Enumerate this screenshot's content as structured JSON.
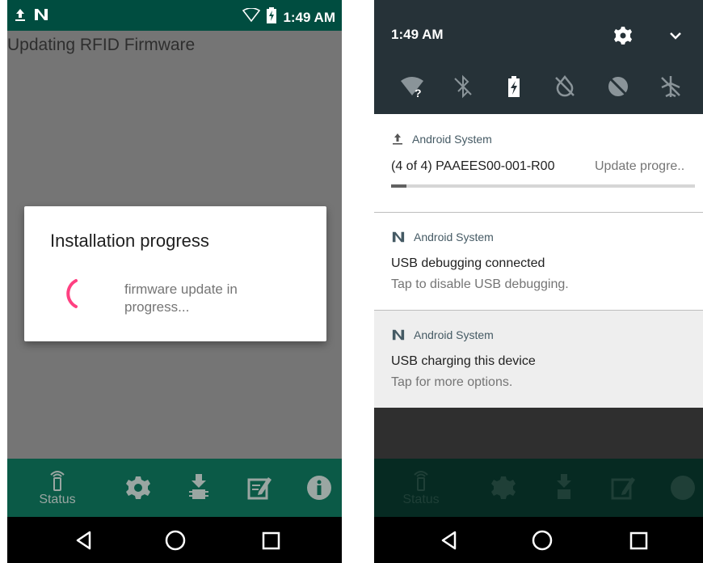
{
  "left": {
    "status": {
      "time": "1:49 AM"
    },
    "activity_title": "Updating RFID Firmware",
    "dialog": {
      "title": "Installation progress",
      "message_line1": "firmware update in",
      "message_line2": "progress..."
    },
    "tabs": [
      {
        "label": "Status",
        "icon": "rfid-icon"
      },
      {
        "label": "",
        "icon": "gear-icon"
      },
      {
        "label": "",
        "icon": "firmware-icon"
      },
      {
        "label": "",
        "icon": "edit-icon"
      },
      {
        "label": "",
        "icon": "info-icon"
      }
    ]
  },
  "right": {
    "qs_time": "1:49 AM",
    "notifications": [
      {
        "app": "Android System",
        "title": "(4 of 4) PAAEES00-001-R00",
        "right_text": "Update progre..",
        "progress": 0.05
      },
      {
        "app": "Android System",
        "title": "USB debugging connected",
        "text": "Tap to disable USB debugging."
      },
      {
        "app": "Android System",
        "title": "USB charging this device",
        "text": "Tap for more options."
      }
    ],
    "tabs_label": "Status"
  },
  "colors": {
    "status_bar": "#004d40",
    "tab_bar": "#0b5a47",
    "spinner": "#ff4081",
    "qs_background": "#263238"
  }
}
